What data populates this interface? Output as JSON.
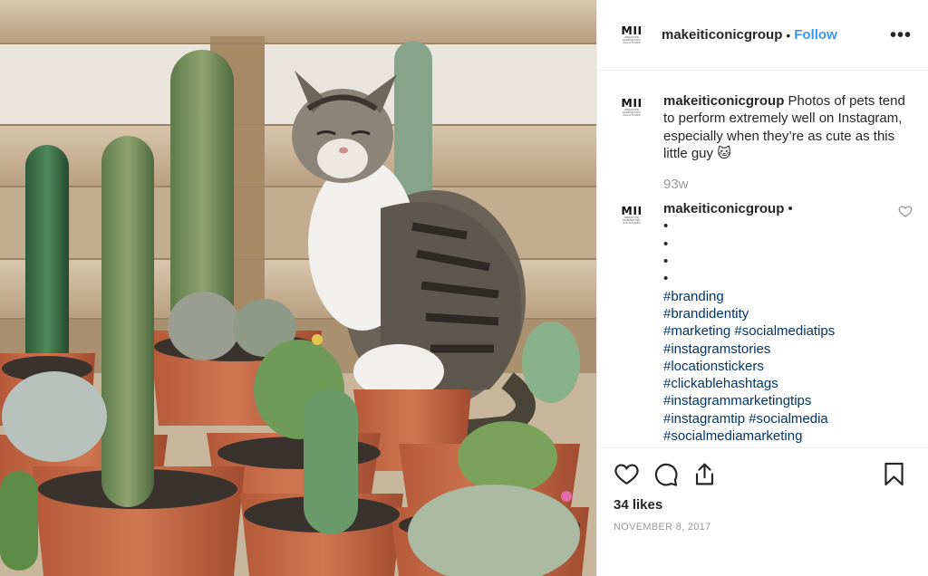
{
  "account": {
    "username": "makeiticonicgroup",
    "avatar_mark": "MII",
    "avatar_tagline": "CREATIVE MARKETING SOLUTIONS"
  },
  "header": {
    "separator": "•",
    "follow_label": "Follow",
    "more_label": "•••"
  },
  "caption": {
    "username": "makeiticonicgroup",
    "text": "Photos of pets tend to perform extremely well on Instagram, especially when they’re as cute as this little guy 🐱",
    "age": "93w"
  },
  "comment": {
    "username": "makeiticonicgroup",
    "trail": "•",
    "bullets": [
      "•",
      "•",
      "•",
      "•"
    ],
    "hashtags": [
      "#branding",
      "#brandidentity",
      "#marketing #socialmediatips",
      "#instagramstories",
      "#locationstickers",
      "#clickablehashtags",
      "#instagrammarketingtips",
      "#instagramtip #socialmedia",
      "#socialmediamarketing"
    ]
  },
  "footer": {
    "likes": "34 likes",
    "date": "NOVEMBER 8, 2017"
  },
  "icons": {
    "like": "heart-icon",
    "comment": "comment-bubble-icon",
    "share": "share-upload-icon",
    "save": "bookmark-icon",
    "more": "more-options-icon",
    "comment_like": "small-heart-icon"
  },
  "colors": {
    "link_blue": "#3897f0",
    "hashtag": "#003569",
    "muted": "#999999",
    "text": "#262626",
    "divider": "#efefef"
  }
}
